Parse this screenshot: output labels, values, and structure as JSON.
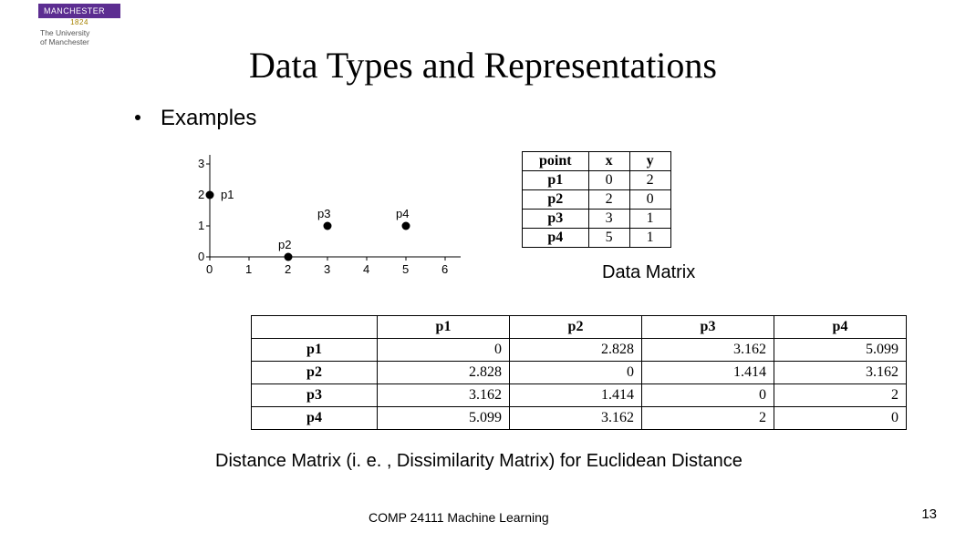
{
  "branding": {
    "name": "MANCHESTER",
    "year": "1824",
    "sub1": "The University",
    "sub2": "of Manchester"
  },
  "title": "Data Types and Representations",
  "bullet": "Examples",
  "chart_data": {
    "type": "scatter",
    "title": "",
    "xlabel": "",
    "ylabel": "",
    "xlim": [
      0,
      6
    ],
    "ylim": [
      0,
      3
    ],
    "x_ticks": [
      0,
      1,
      2,
      3,
      4,
      5,
      6
    ],
    "y_ticks": [
      0,
      1,
      2,
      3
    ],
    "series": [
      {
        "name": "points",
        "labels": [
          "p1",
          "p2",
          "p3",
          "p4"
        ],
        "x": [
          0,
          2,
          3,
          5
        ],
        "y": [
          2,
          0,
          1,
          1
        ]
      }
    ]
  },
  "data_matrix": {
    "headers": [
      "point",
      "x",
      "y"
    ],
    "rows": [
      [
        "p1",
        "0",
        "2"
      ],
      [
        "p2",
        "2",
        "0"
      ],
      [
        "p3",
        "3",
        "1"
      ],
      [
        "p4",
        "5",
        "1"
      ]
    ],
    "label": "Data Matrix"
  },
  "distance_matrix": {
    "headers": [
      "",
      "p1",
      "p2",
      "p3",
      "p4"
    ],
    "rows": [
      [
        "p1",
        "0",
        "2.828",
        "3.162",
        "5.099"
      ],
      [
        "p2",
        "2.828",
        "0",
        "1.414",
        "3.162"
      ],
      [
        "p3",
        "3.162",
        "1.414",
        "0",
        "2"
      ],
      [
        "p4",
        "5.099",
        "3.162",
        "2",
        "0"
      ]
    ],
    "caption": "Distance Matrix (i. e. , Dissimilarity Matrix) for Euclidean Distance"
  },
  "footer": "COMP 24111  Machine Learning",
  "page": "13"
}
